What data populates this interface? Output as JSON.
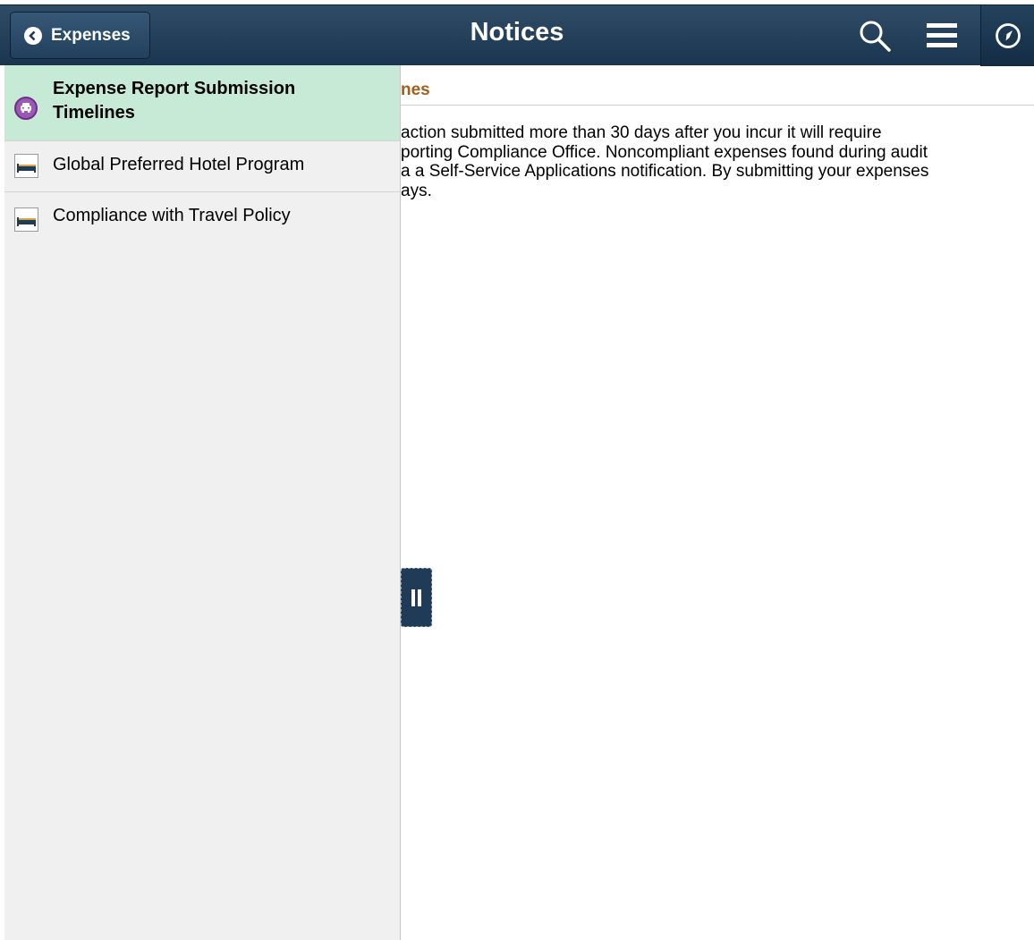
{
  "header": {
    "back_label": "Expenses",
    "title": "Notices",
    "icons": [
      "search-icon",
      "menu-icon",
      "navbar-compass-icon"
    ],
    "background": "#1f3b57"
  },
  "sidebar": {
    "items": [
      {
        "label_line1": "Expense Report Submission",
        "label_line2": "Timelines",
        "icon": "car-icon",
        "selected": true
      },
      {
        "label": "Global Preferred Hotel Program",
        "icon": "bed-icon",
        "selected": false
      },
      {
        "label": "Compliance with Travel Policy",
        "icon": "bed-icon",
        "selected": false
      }
    ],
    "selected_color": "#c7ead6"
  },
  "content": {
    "title_fragment": "nes",
    "lines": [
      "action submitted more than 30 days after you incur it will require",
      "porting Compliance Office. Noncompliant expenses found during audit",
      "a a Self-Service Applications notification. By submitting your expenses",
      "ays."
    ],
    "title_color": "#a45c1a"
  },
  "splitter": {
    "icon": "pause-icon"
  }
}
